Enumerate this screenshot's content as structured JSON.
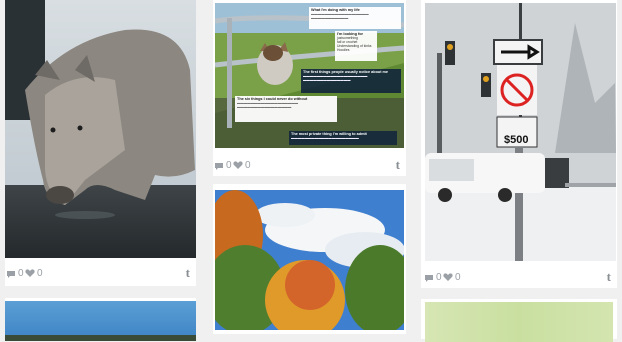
{
  "cards": [
    {
      "comments": "0",
      "likes": "0",
      "tumblr": "t"
    },
    {
      "comments": "0",
      "likes": "0",
      "tumblr": "t"
    },
    {
      "comments": "0",
      "likes": "0",
      "tumblr": "t"
    }
  ],
  "collage": {
    "title1": "What I'm doing with my life",
    "title2": "I'm looking for",
    "items2": [
      "justsomething",
      "fall or crochet",
      "Understanding of kinks",
      "Hoodies"
    ],
    "title3": "The first things people usually notice about me",
    "title4": "The six things I could never do without",
    "title5": "The most private thing I'm willing to admit"
  },
  "sign": {
    "price": "$500"
  }
}
